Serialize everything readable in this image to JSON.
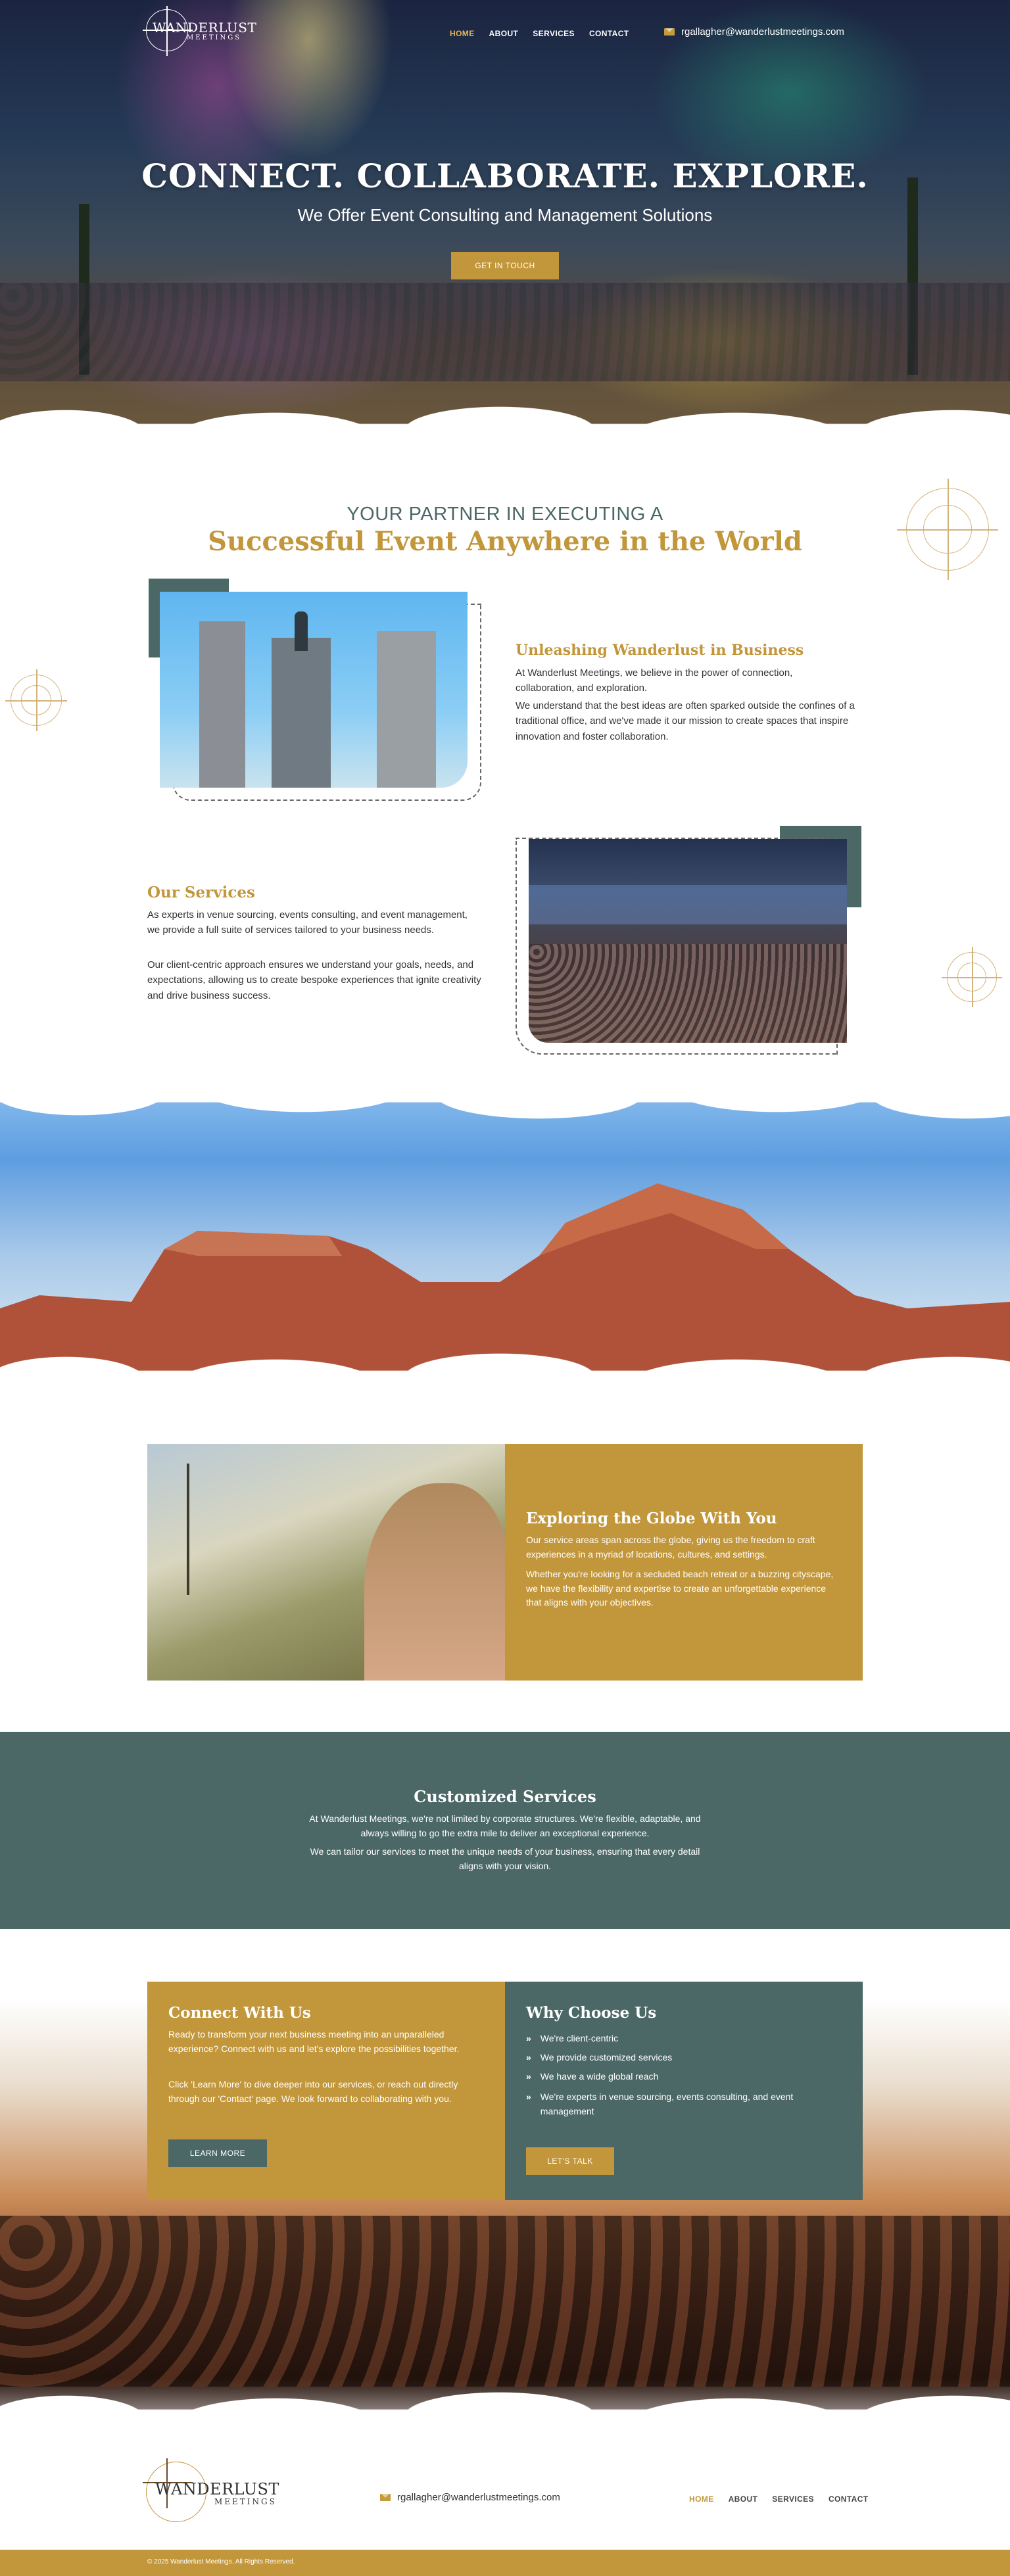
{
  "brand": {
    "name_line1": "WANDERLUST",
    "name_line2": "MEETINGS"
  },
  "nav": {
    "items": [
      "HOME",
      "ABOUT",
      "SERVICES",
      "CONTACT"
    ],
    "active": "HOME"
  },
  "contact": {
    "email": "rgallagher@wanderlustmeetings.com"
  },
  "hero": {
    "title": "CONNECT. COLLABORATE. EXPLORE.",
    "subtitle": "We Offer Event Consulting and Management Solutions",
    "cta": "GET IN TOUCH"
  },
  "partner": {
    "kicker": "YOUR PARTNER IN EXECUTING A",
    "headline": "Successful Event Anywhere in the World"
  },
  "unleashing": {
    "title": "Unleashing Wanderlust in Business",
    "p1": "At Wanderlust Meetings, we believe in the power of connection, collaboration, and exploration.",
    "p2": "We understand that the best ideas are often sparked outside the confines of a traditional office, and we've made it our mission to create spaces that inspire innovation and foster collaboration."
  },
  "services": {
    "title": "Our Services",
    "p1": "As experts in venue sourcing, events consulting, and event management, we provide a full suite of services tailored to your business needs.",
    "p2": "Our client-centric approach ensures we understand your goals, needs, and expectations, allowing us to create bespoke experiences that ignite creativity and drive business success."
  },
  "globe": {
    "title": "Exploring the Globe With You",
    "p1": "Our service areas span across the globe, giving us the freedom to craft experiences in a myriad of locations, cultures, and settings.",
    "p2": "Whether you're looking for a secluded beach retreat or a buzzing cityscape, we have the flexibility and expertise to create an unforgettable experience that aligns with your objectives."
  },
  "customized": {
    "title": "Customized Services",
    "p1": "At Wanderlust Meetings, we're not limited by corporate structures. We're flexible, adaptable, and always willing to go the extra mile to deliver an exceptional experience.",
    "p2": "We can tailor our services to meet the unique needs of your business, ensuring that every detail aligns with your vision."
  },
  "connect": {
    "title": "Connect With Us",
    "p1": "Ready to transform your next business meeting into an unparalleled experience? Connect with us and let's explore the possibilities together.",
    "p2": "Click 'Learn More' to dive deeper into our services, or reach out directly through our 'Contact' page. We look forward to collaborating with you.",
    "cta": "LEARN MORE"
  },
  "why": {
    "title": "Why Choose Us",
    "items": [
      "We're client-centric",
      "We provide customized services",
      "We have a wide global reach",
      "We're experts in venue sourcing, events consulting, and event management"
    ],
    "cta": "LET'S TALK"
  },
  "footer": {
    "copyright": "© 2025 Wanderlust Meetings. All Rights Reserved."
  },
  "colors": {
    "gold": "#c2963a",
    "teal": "#4b6866",
    "white": "#ffffff"
  }
}
